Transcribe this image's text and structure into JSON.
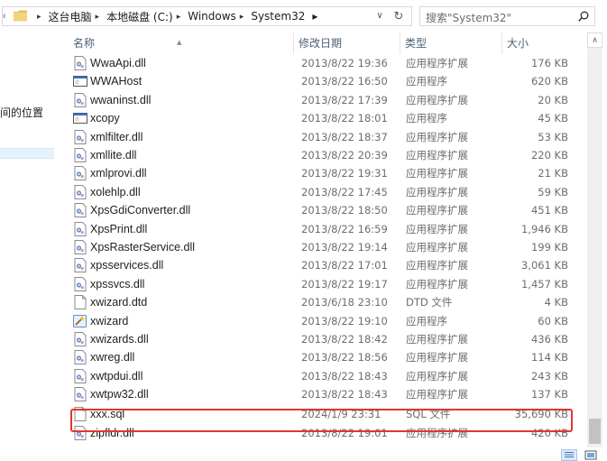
{
  "address": {
    "crumbs": [
      "这台电脑",
      "本地磁盘 (C:)",
      "Windows",
      "System32"
    ],
    "icons": {
      "dropdown": "chevron-down-icon",
      "refresh": "refresh-icon",
      "folder": "folder-icon"
    }
  },
  "search": {
    "placeholder": "搜索\"System32\""
  },
  "nav": {
    "partial_item": "间的位置"
  },
  "columns": {
    "name": "名称",
    "date": "修改日期",
    "type": "类型",
    "size": "大小"
  },
  "files": [
    {
      "name": "WwaApi.dll",
      "date": "2013/8/22 19:36",
      "type": "应用程序扩展",
      "size": "176 KB",
      "icon": "dll"
    },
    {
      "name": "WWAHost",
      "date": "2013/8/22 16:50",
      "type": "应用程序",
      "size": "620 KB",
      "icon": "exe"
    },
    {
      "name": "wwaninst.dll",
      "date": "2013/8/22 17:39",
      "type": "应用程序扩展",
      "size": "20 KB",
      "icon": "dll"
    },
    {
      "name": "xcopy",
      "date": "2013/8/22 18:01",
      "type": "应用程序",
      "size": "45 KB",
      "icon": "exe"
    },
    {
      "name": "xmlfilter.dll",
      "date": "2013/8/22 18:37",
      "type": "应用程序扩展",
      "size": "53 KB",
      "icon": "dll"
    },
    {
      "name": "xmllite.dll",
      "date": "2013/8/22 20:39",
      "type": "应用程序扩展",
      "size": "220 KB",
      "icon": "dll"
    },
    {
      "name": "xmlprovi.dll",
      "date": "2013/8/22 19:31",
      "type": "应用程序扩展",
      "size": "21 KB",
      "icon": "dll"
    },
    {
      "name": "xolehlp.dll",
      "date": "2013/8/22 17:45",
      "type": "应用程序扩展",
      "size": "59 KB",
      "icon": "dll"
    },
    {
      "name": "XpsGdiConverter.dll",
      "date": "2013/8/22 18:50",
      "type": "应用程序扩展",
      "size": "451 KB",
      "icon": "dll"
    },
    {
      "name": "XpsPrint.dll",
      "date": "2013/8/22 16:59",
      "type": "应用程序扩展",
      "size": "1,946 KB",
      "icon": "dll"
    },
    {
      "name": "XpsRasterService.dll",
      "date": "2013/8/22 19:14",
      "type": "应用程序扩展",
      "size": "199 KB",
      "icon": "dll"
    },
    {
      "name": "xpsservices.dll",
      "date": "2013/8/22 17:01",
      "type": "应用程序扩展",
      "size": "3,061 KB",
      "icon": "dll"
    },
    {
      "name": "xpssvcs.dll",
      "date": "2013/8/22 19:17",
      "type": "应用程序扩展",
      "size": "1,457 KB",
      "icon": "dll"
    },
    {
      "name": "xwizard.dtd",
      "date": "2013/6/18 23:10",
      "type": "DTD 文件",
      "size": "4 KB",
      "icon": "doc"
    },
    {
      "name": "xwizard",
      "date": "2013/8/22 19:10",
      "type": "应用程序",
      "size": "60 KB",
      "icon": "wizard"
    },
    {
      "name": "xwizards.dll",
      "date": "2013/8/22 18:42",
      "type": "应用程序扩展",
      "size": "436 KB",
      "icon": "dll"
    },
    {
      "name": "xwreg.dll",
      "date": "2013/8/22 18:56",
      "type": "应用程序扩展",
      "size": "114 KB",
      "icon": "dll"
    },
    {
      "name": "xwtpdui.dll",
      "date": "2013/8/22 18:43",
      "type": "应用程序扩展",
      "size": "243 KB",
      "icon": "dll"
    },
    {
      "name": "xwtpw32.dll",
      "date": "2013/8/22 18:43",
      "type": "应用程序扩展",
      "size": "137 KB",
      "icon": "dll"
    },
    {
      "name": "xxx.sql",
      "date": "2024/1/9 23:31",
      "type": "SQL 文件",
      "size": "35,690 KB",
      "icon": "doc",
      "highlighted": true
    },
    {
      "name": "zipfldr.dll",
      "date": "2013/8/22 19:01",
      "type": "应用程序扩展",
      "size": "420 KB",
      "icon": "dll"
    }
  ],
  "colors": {
    "highlight_border": "#e53333",
    "header_text": "#4c607a",
    "meta_text": "#6d6d6d"
  }
}
